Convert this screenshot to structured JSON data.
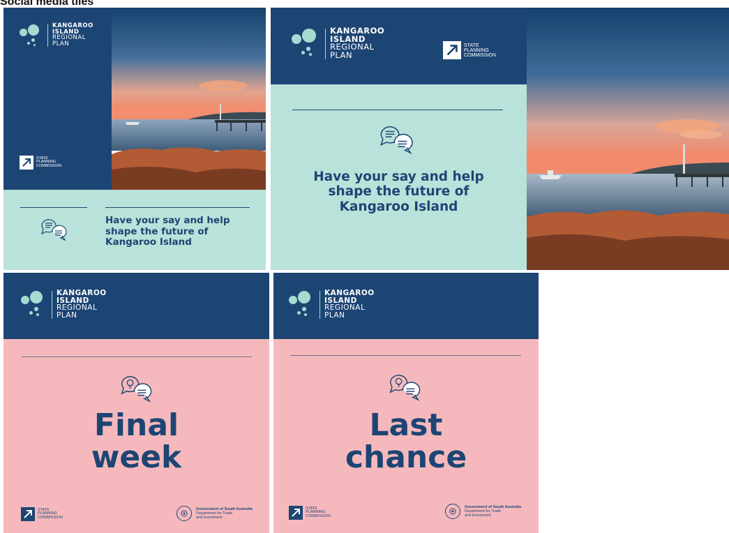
{
  "heading": "Social media tiles",
  "logo": {
    "line1": "KANGAROO",
    "line2": "ISLAND",
    "line3": "REGIONAL",
    "line4": "PLAN"
  },
  "spc": {
    "line1": "STATE",
    "line2": "PLANNING",
    "line3": "COMMISSION"
  },
  "tagline": {
    "line1": "Have your say and help",
    "line2": "shape the future of",
    "line3": "Kangaroo Island"
  },
  "tile3": {
    "line1": "Final",
    "line2": "week"
  },
  "tile4": {
    "line1": "Last",
    "line2": "chance"
  },
  "gov": {
    "line1": "Government of South Australia",
    "line2": "Department for Trade",
    "line3": "and Investment"
  },
  "colors": {
    "navy": "#1d4574",
    "mint": "#b9e2da",
    "pink": "#f5b9bd",
    "accent": "#a6dbd2"
  }
}
